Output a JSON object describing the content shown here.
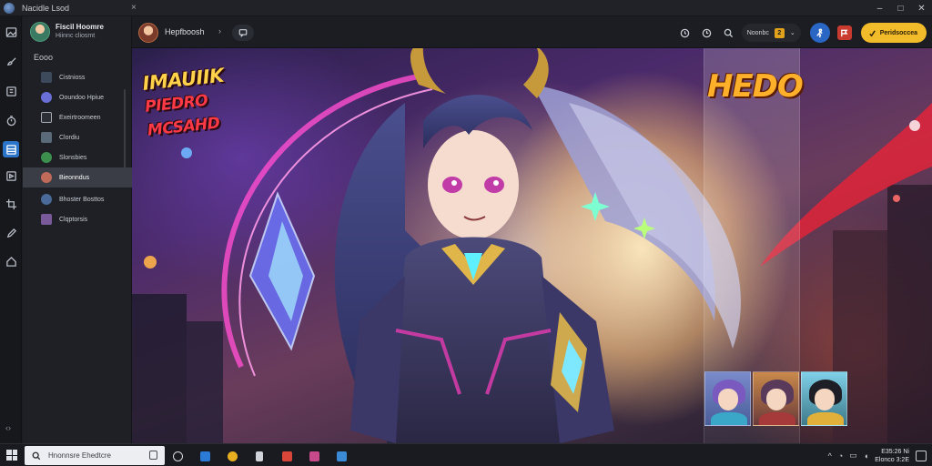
{
  "window": {
    "title": "Nacidle Lsod",
    "tab_close": "×",
    "controls": {
      "minimize": "–",
      "maximize": "□",
      "close": "✕"
    }
  },
  "rail": {
    "items": [
      {
        "icon": "image-icon"
      },
      {
        "icon": "brush-icon"
      },
      {
        "icon": "layers-icon"
      },
      {
        "icon": "timer-icon"
      },
      {
        "icon": "gallery-icon",
        "active": true
      },
      {
        "icon": "frame-icon"
      },
      {
        "icon": "crop-icon"
      },
      {
        "icon": "pen-icon"
      },
      {
        "icon": "home-icon"
      }
    ],
    "bottom": "‹›"
  },
  "sidebar": {
    "profile": {
      "name": "Fiscil Hoomre",
      "sub": "Hiinnc cliosmt"
    },
    "section": "Eooo",
    "items": [
      {
        "label": "Cistnioss",
        "color": "#3c4a5c"
      },
      {
        "label": "Ooundoo Hpiue",
        "color": "#6a6fd6"
      },
      {
        "label": "Exeirtroomeen",
        "color": "#2c2f36"
      },
      {
        "label": "Clordiu",
        "color": "#5a6a78"
      },
      {
        "label": "Slonsbies",
        "color": "#3d8f4e"
      },
      {
        "label": "Bieonndus",
        "color": "#c06a5a",
        "active": true
      },
      {
        "label": "Bhoster Bosttos",
        "color": "#4a6a9a"
      },
      {
        "label": "Clqptorsis",
        "color": "#7a5a9a"
      }
    ]
  },
  "toolbar": {
    "user": "Hepfboosh",
    "chevron": "›",
    "search_value": "Noonbc",
    "badge": "2",
    "chevron2": "⌄",
    "cta": "Peridsoccea"
  },
  "stage": {
    "hero_line1": "IMAUIIK",
    "hero_line2": "PIEDRO MCSAHD",
    "panel_title": "HEDO"
  },
  "taskbar": {
    "search_placeholder": "Hnonnsre Ehedtcre",
    "clock_time": "E35:26 Ni",
    "clock_date": "Elonco 3:2E"
  },
  "colors": {
    "accent": "#2a74c9",
    "cta": "#f2bb2a",
    "hero_yellow": "#ffd24a",
    "hero_red": "#ff3a46",
    "panel_title": "#ffb02a"
  }
}
